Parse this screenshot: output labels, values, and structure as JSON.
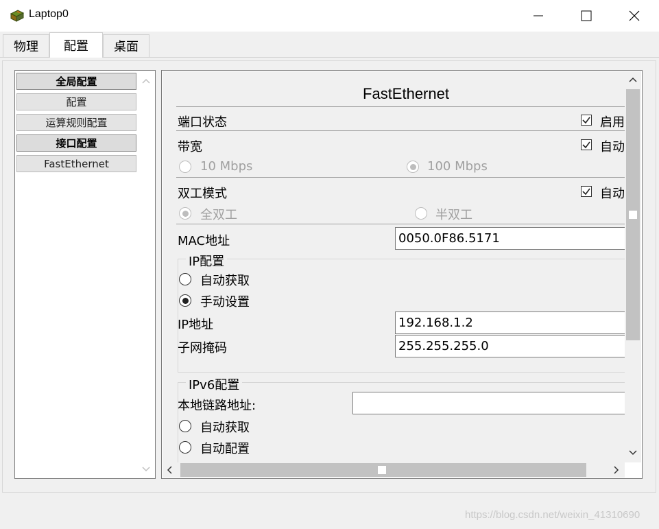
{
  "window": {
    "title": "Laptop0"
  },
  "tabs": [
    "物理",
    "配置",
    "桌面"
  ],
  "nav": {
    "items": [
      {
        "label": "全局配置"
      },
      {
        "label": "配置"
      },
      {
        "label": "运算规则配置"
      },
      {
        "label": "接口配置"
      },
      {
        "label": "FastEthernet"
      }
    ]
  },
  "panel": {
    "heading": "FastEthernet",
    "port_status": {
      "label": "端口状态",
      "checkbox_label": "启用",
      "checked": true
    },
    "bandwidth": {
      "label": "带宽",
      "checkbox_label": "自动",
      "checked": true,
      "options": [
        "10 Mbps",
        "100 Mbps"
      ]
    },
    "duplex": {
      "label": "双工模式",
      "checkbox_label": "自动",
      "checked": true,
      "options": [
        "全双工",
        "半双工"
      ]
    },
    "mac": {
      "label": "MAC地址",
      "value": "0050.0F86.5171"
    },
    "ip_config": {
      "group_label": "IP配置",
      "options": [
        "自动获取",
        "手动设置"
      ],
      "ip_label": "IP地址",
      "ip_value": "192.168.1.2",
      "mask_label": "子网掩码",
      "mask_value": "255.255.255.0"
    },
    "ipv6_config": {
      "group_label": "IPv6配置",
      "link_local_label": "本地链路地址:",
      "link_local_value": "",
      "options": [
        "自动获取",
        "自动配置"
      ]
    }
  },
  "watermark": "https://blog.csdn.net/weixin_41310690"
}
